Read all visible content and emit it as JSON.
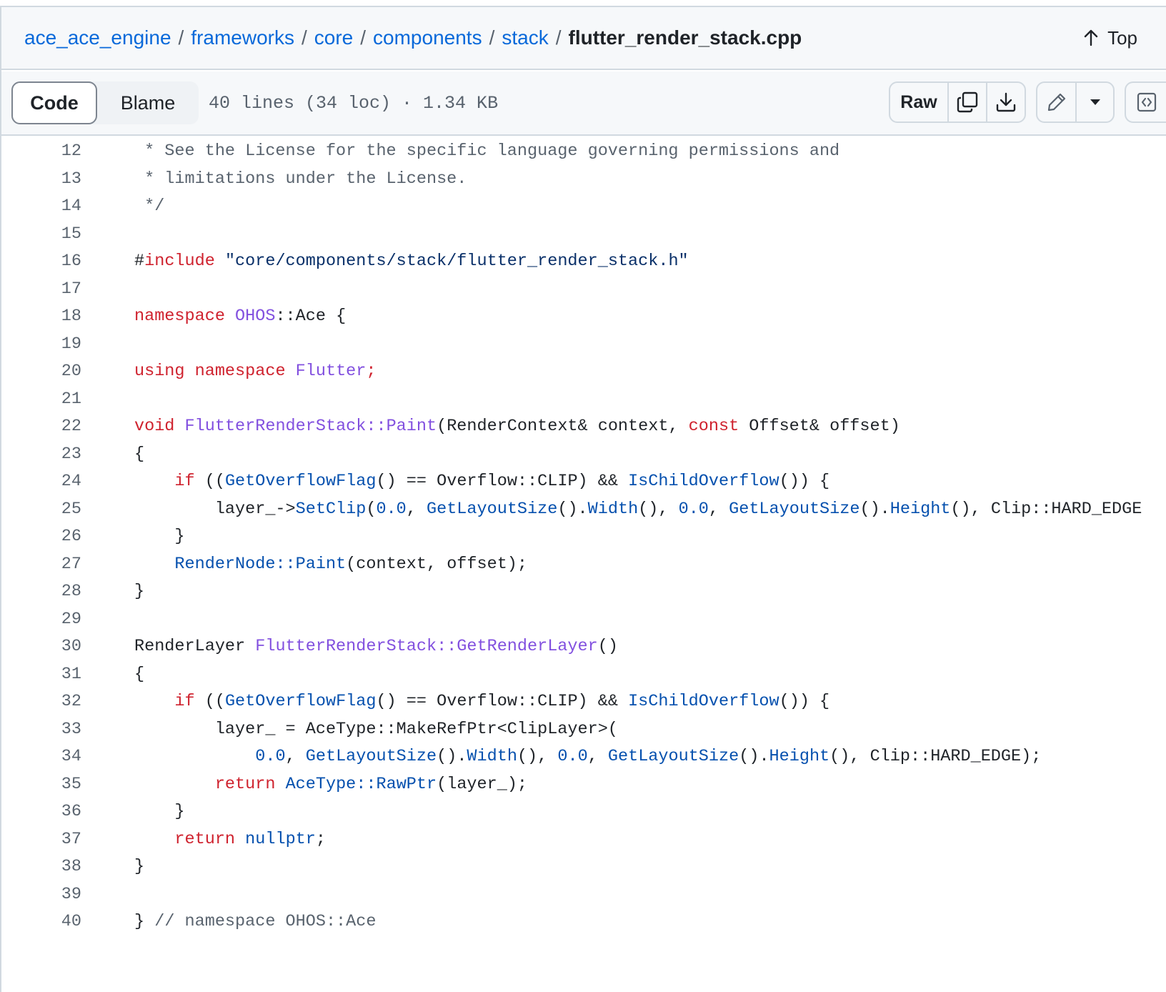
{
  "breadcrumb": {
    "repo": "ace_ace_engine",
    "dirs": [
      "frameworks",
      "core",
      "components",
      "stack"
    ],
    "separator": "/",
    "file": "flutter_render_stack.cpp"
  },
  "top_link": {
    "label": "Top"
  },
  "toolbar": {
    "code_tab": "Code",
    "blame_tab": "Blame",
    "file_info": "40 lines (34 loc) · 1.34 KB",
    "raw_label": "Raw"
  },
  "icons": {
    "top": "arrow-up-icon",
    "copy": "copy-icon",
    "download": "download-icon",
    "edit": "pencil-icon",
    "more": "triangle-down-icon",
    "symbols": "code-square-icon"
  },
  "colors": {
    "keyword": "#cf222e",
    "function": "#8250df",
    "string": "#0a3069",
    "constant": "#0550ae",
    "comment": "#59636e",
    "link": "#0969da"
  },
  "code_lines": [
    {
      "n": "12",
      "tokens": [
        [
          "cm",
          " * See the License for the specific language governing permissions and"
        ]
      ]
    },
    {
      "n": "13",
      "tokens": [
        [
          "cm",
          " * limitations under the License."
        ]
      ]
    },
    {
      "n": "14",
      "tokens": [
        [
          "cm",
          " */"
        ]
      ]
    },
    {
      "n": "15",
      "tokens": []
    },
    {
      "n": "16",
      "tokens": [
        [
          "plain",
          "#"
        ],
        [
          "kw",
          "include"
        ],
        [
          "plain",
          " "
        ],
        [
          "str",
          "\"core/components/stack/flutter_render_stack.h\""
        ]
      ]
    },
    {
      "n": "17",
      "tokens": []
    },
    {
      "n": "18",
      "tokens": [
        [
          "kw",
          "namespace"
        ],
        [
          "plain",
          " "
        ],
        [
          "fn",
          "OHOS"
        ],
        [
          "plain",
          "::Ace {"
        ]
      ]
    },
    {
      "n": "19",
      "tokens": []
    },
    {
      "n": "20",
      "tokens": [
        [
          "kw",
          "using"
        ],
        [
          "plain",
          " "
        ],
        [
          "kw",
          "namespace"
        ],
        [
          "plain",
          " "
        ],
        [
          "fn",
          "Flutter"
        ],
        [
          "kw",
          ";"
        ]
      ]
    },
    {
      "n": "21",
      "tokens": []
    },
    {
      "n": "22",
      "tokens": [
        [
          "kw",
          "void"
        ],
        [
          "plain",
          " "
        ],
        [
          "fn",
          "FlutterRenderStack::Paint"
        ],
        [
          "plain",
          "(RenderContext& context, "
        ],
        [
          "kw",
          "const"
        ],
        [
          "plain",
          " Offset& offset)"
        ]
      ]
    },
    {
      "n": "23",
      "tokens": [
        [
          "plain",
          "{"
        ]
      ]
    },
    {
      "n": "24",
      "tokens": [
        [
          "plain",
          "    "
        ],
        [
          "kw",
          "if"
        ],
        [
          "plain",
          " (("
        ],
        [
          "num",
          "GetOverflowFlag"
        ],
        [
          "plain",
          "() == Overflow::CLIP) && "
        ],
        [
          "num",
          "IsChildOverflow"
        ],
        [
          "plain",
          "()) {"
        ]
      ]
    },
    {
      "n": "25",
      "tokens": [
        [
          "plain",
          "        layer_->"
        ],
        [
          "num",
          "SetClip"
        ],
        [
          "plain",
          "("
        ],
        [
          "num",
          "0.0"
        ],
        [
          "plain",
          ", "
        ],
        [
          "num",
          "GetLayoutSize"
        ],
        [
          "plain",
          "()."
        ],
        [
          "num",
          "Width"
        ],
        [
          "plain",
          "(), "
        ],
        [
          "num",
          "0.0"
        ],
        [
          "plain",
          ", "
        ],
        [
          "num",
          "GetLayoutSize"
        ],
        [
          "plain",
          "()."
        ],
        [
          "num",
          "Height"
        ],
        [
          "plain",
          "(), Clip::HARD_EDGE"
        ]
      ]
    },
    {
      "n": "26",
      "tokens": [
        [
          "plain",
          "    }"
        ]
      ]
    },
    {
      "n": "27",
      "tokens": [
        [
          "plain",
          "    "
        ],
        [
          "num",
          "RenderNode::Paint"
        ],
        [
          "plain",
          "(context, offset);"
        ]
      ]
    },
    {
      "n": "28",
      "tokens": [
        [
          "plain",
          "}"
        ]
      ]
    },
    {
      "n": "29",
      "tokens": []
    },
    {
      "n": "30",
      "tokens": [
        [
          "plain",
          "RenderLayer "
        ],
        [
          "fn",
          "FlutterRenderStack::GetRenderLayer"
        ],
        [
          "plain",
          "()"
        ]
      ]
    },
    {
      "n": "31",
      "tokens": [
        [
          "plain",
          "{"
        ]
      ]
    },
    {
      "n": "32",
      "tokens": [
        [
          "plain",
          "    "
        ],
        [
          "kw",
          "if"
        ],
        [
          "plain",
          " (("
        ],
        [
          "num",
          "GetOverflowFlag"
        ],
        [
          "plain",
          "() == Overflow::CLIP) && "
        ],
        [
          "num",
          "IsChildOverflow"
        ],
        [
          "plain",
          "()) {"
        ]
      ]
    },
    {
      "n": "33",
      "tokens": [
        [
          "plain",
          "        layer_ = AceType::MakeRefPtr<ClipLayer>("
        ]
      ]
    },
    {
      "n": "34",
      "tokens": [
        [
          "plain",
          "            "
        ],
        [
          "num",
          "0.0"
        ],
        [
          "plain",
          ", "
        ],
        [
          "num",
          "GetLayoutSize"
        ],
        [
          "plain",
          "()."
        ],
        [
          "num",
          "Width"
        ],
        [
          "plain",
          "(), "
        ],
        [
          "num",
          "0.0"
        ],
        [
          "plain",
          ", "
        ],
        [
          "num",
          "GetLayoutSize"
        ],
        [
          "plain",
          "()."
        ],
        [
          "num",
          "Height"
        ],
        [
          "plain",
          "(), Clip::HARD_EDGE);"
        ]
      ]
    },
    {
      "n": "35",
      "tokens": [
        [
          "plain",
          "        "
        ],
        [
          "kw",
          "return"
        ],
        [
          "plain",
          " "
        ],
        [
          "num",
          "AceType::RawPtr"
        ],
        [
          "plain",
          "(layer_);"
        ]
      ]
    },
    {
      "n": "36",
      "tokens": [
        [
          "plain",
          "    }"
        ]
      ]
    },
    {
      "n": "37",
      "tokens": [
        [
          "plain",
          "    "
        ],
        [
          "kw",
          "return"
        ],
        [
          "plain",
          " "
        ],
        [
          "num",
          "nullptr"
        ],
        [
          "plain",
          ";"
        ]
      ]
    },
    {
      "n": "38",
      "tokens": [
        [
          "plain",
          "}"
        ]
      ]
    },
    {
      "n": "39",
      "tokens": []
    },
    {
      "n": "40",
      "tokens": [
        [
          "plain",
          "} "
        ],
        [
          "cm",
          "// namespace OHOS::Ace"
        ]
      ]
    }
  ]
}
